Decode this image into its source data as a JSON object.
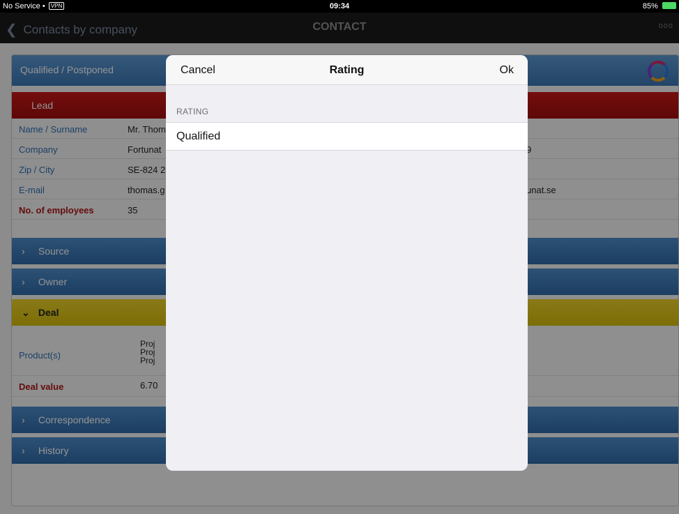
{
  "status_bar": {
    "carrier": "No Service",
    "vpn": "VPN",
    "time": "09:34",
    "battery": "85%"
  },
  "nav": {
    "back_label": "Contacts by company",
    "title": "CONTACT",
    "more": "ooo"
  },
  "header": {
    "label": "Qualified / Postponed"
  },
  "lead": {
    "label": "Lead"
  },
  "fields": [
    {
      "key": "Name / Surname",
      "value": "Mr. Thom",
      "right": ""
    },
    {
      "key": "Company",
      "value": "Fortunat",
      "right": "9"
    },
    {
      "key": "Zip / City",
      "value": "SE-824 2",
      "right": ""
    },
    {
      "key": "E-mail",
      "value": "thomas.g",
      "right": "unat.se"
    },
    {
      "key": "No. of employees",
      "value": "35",
      "right": ""
    }
  ],
  "sections": {
    "source": "Source",
    "owner": "Owner",
    "deal": "Deal",
    "correspondence": "Correspondence",
    "history": "History"
  },
  "deal": {
    "products_label": "Product(s)",
    "products": [
      "Proj",
      "Proj",
      "Proj"
    ],
    "value_label": "Deal value",
    "value": "6.70"
  },
  "modal": {
    "cancel": "Cancel",
    "title": "Rating",
    "ok": "Ok",
    "section_label": "RATING",
    "option": "Qualified"
  }
}
